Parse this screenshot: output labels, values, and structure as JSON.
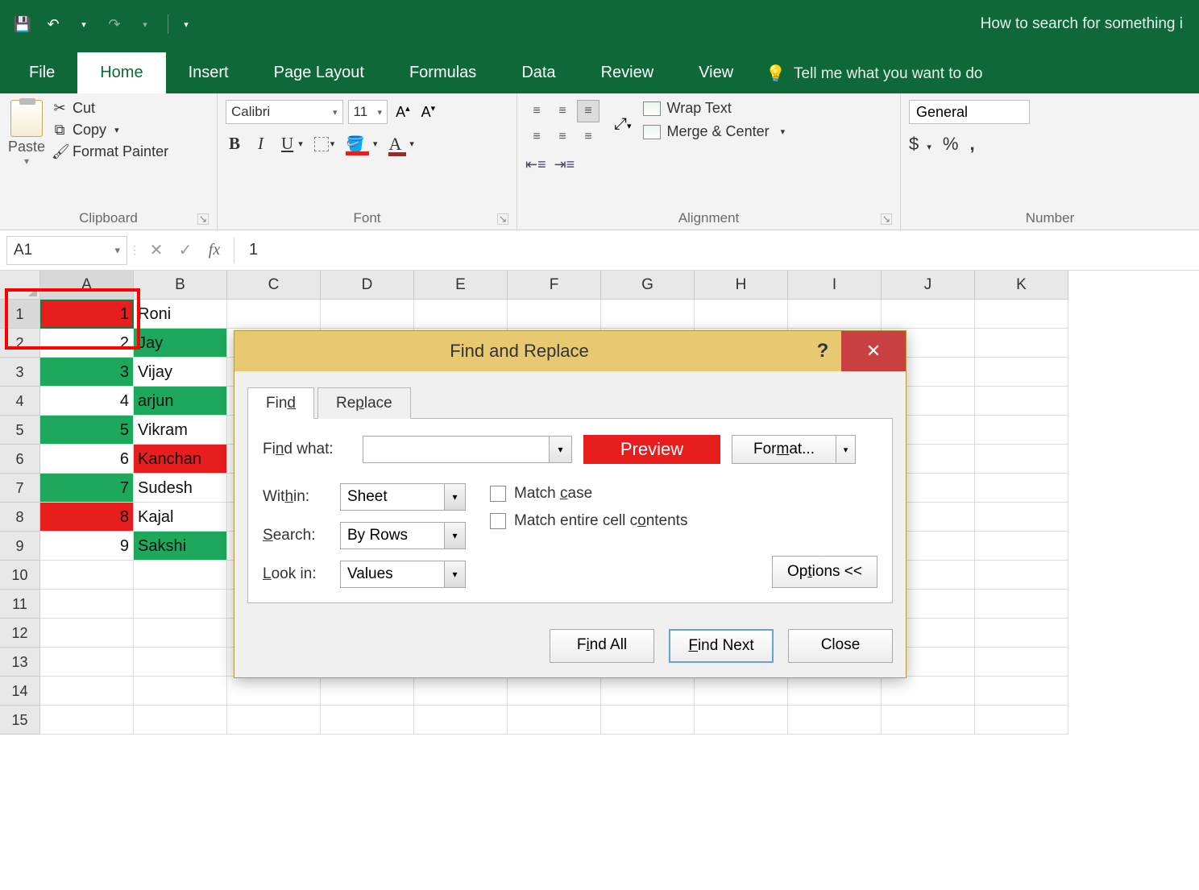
{
  "titlebar": {
    "title_suffix": "How to search for something i"
  },
  "tabs": {
    "file": "File",
    "home": "Home",
    "insert": "Insert",
    "page_layout": "Page Layout",
    "formulas": "Formulas",
    "data": "Data",
    "review": "Review",
    "view": "View",
    "tellme": "Tell me what you want to do"
  },
  "ribbon": {
    "clipboard": {
      "paste": "Paste",
      "cut": "Cut",
      "copy": "Copy",
      "format_painter": "Format Painter",
      "group": "Clipboard"
    },
    "font": {
      "name": "Calibri",
      "size": "11",
      "bold": "B",
      "italic": "I",
      "underline": "U",
      "group": "Font"
    },
    "alignment": {
      "wrap": "Wrap Text",
      "merge": "Merge & Center",
      "group": "Alignment"
    },
    "number": {
      "format": "General",
      "currency": "$",
      "percent": "%",
      "comma": ",",
      "group": "Number"
    }
  },
  "formula_bar": {
    "name_box": "A1",
    "value": "1"
  },
  "columns": [
    "A",
    "B",
    "C",
    "D",
    "E",
    "F",
    "G",
    "H",
    "I",
    "J",
    "K"
  ],
  "row_count": 15,
  "cells": {
    "A": [
      {
        "v": "1",
        "bg": "#e81e1e"
      },
      {
        "v": "2",
        "bg": ""
      },
      {
        "v": "3",
        "bg": "#1ea85e"
      },
      {
        "v": "4",
        "bg": ""
      },
      {
        "v": "5",
        "bg": "#1ea85e"
      },
      {
        "v": "6",
        "bg": ""
      },
      {
        "v": "7",
        "bg": "#1ea85e"
      },
      {
        "v": "8",
        "bg": "#e81e1e"
      },
      {
        "v": "9",
        "bg": ""
      }
    ],
    "B": [
      {
        "v": "Roni",
        "bg": ""
      },
      {
        "v": "Jay",
        "bg": "#1ea85e"
      },
      {
        "v": "Vijay",
        "bg": ""
      },
      {
        "v": "arjun",
        "bg": "#1ea85e"
      },
      {
        "v": "Vikram",
        "bg": ""
      },
      {
        "v": "Kanchan",
        "bg": "#e81e1e"
      },
      {
        "v": "Sudesh",
        "bg": ""
      },
      {
        "v": "Kajal",
        "bg": ""
      },
      {
        "v": "Sakshi",
        "bg": "#1ea85e"
      }
    ]
  },
  "dialog": {
    "title": "Find and Replace",
    "tab_find": "Find",
    "tab_replace": "Replace",
    "find_what": "Find what:",
    "preview": "Preview",
    "format": "Format...",
    "within_label": "Within:",
    "within_value": "Sheet",
    "search_label": "Search:",
    "search_value": "By Rows",
    "lookin_label": "Look in:",
    "lookin_value": "Values",
    "match_case": "Match case",
    "match_entire": "Match entire cell contents",
    "options": "Options <<",
    "find_all": "Find All",
    "find_next": "Find Next",
    "close": "Close"
  }
}
